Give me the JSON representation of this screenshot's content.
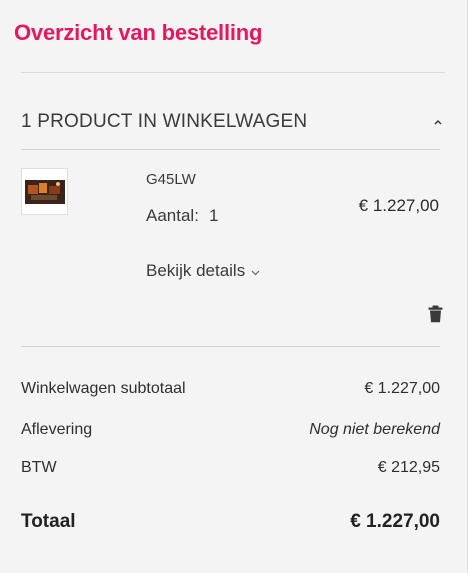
{
  "summary": {
    "title": "Overzicht van bestelling",
    "cart_header": "1 PRODUCT IN WINKELWAGEN"
  },
  "item": {
    "name": "G45LW",
    "qty_label": "Aantal:",
    "qty_value": "1",
    "price": "€ 1.227,00",
    "details_label": "Bekijk details",
    "thumbnail_icon": "product-image",
    "remove_icon": "trash-icon"
  },
  "totals": {
    "subtotal_label": "Winkelwagen subtotaal",
    "subtotal_value": "€ 1.227,00",
    "delivery_label": "Aflevering",
    "delivery_value": "Nog niet berekend",
    "vat_label": "BTW",
    "vat_value": "€ 212,95",
    "total_label": "Totaal",
    "total_value": "€ 1.227,00"
  },
  "colors": {
    "accent": "#e8175d",
    "panel_bg": "#f4f4f4"
  }
}
